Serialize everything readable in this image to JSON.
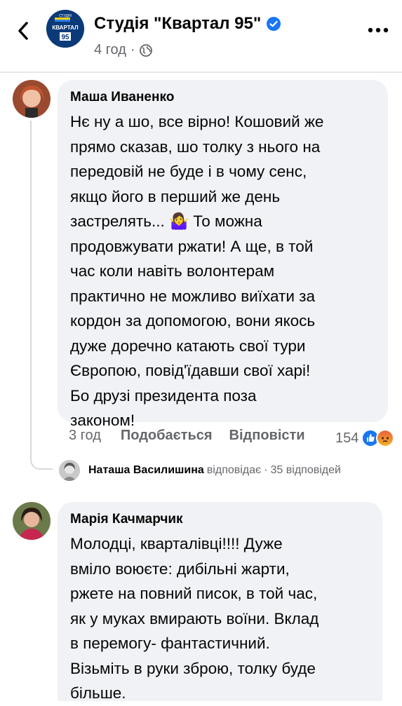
{
  "header": {
    "page_name": "Студія \"Квартал 95\"",
    "time": "4 год",
    "separator": "·",
    "logo_top": "СТУДІЯ",
    "logo_mid": "КВАРТАЛ",
    "logo_num": "95",
    "brand_color": "#0b3a78",
    "verified_color": "#1877f2"
  },
  "comments": [
    {
      "author": "Маша Иваненко",
      "text": "Нє ну а шо, все вірно! Кошовий же\nпрямо сказав, шо толку з нього на\nпередовій не буде і в чому сенс,\nякщо його в перший же день\nзастрелять... 🤷‍♀️ То можна\nпродовжувати ржати! А ще, в той\nчас коли навіть волонтерам\nпрактично не можливо виїхати за\nкордон за допомогою, вони якось\nдуже доречно катають свої тури\nЄвропою, повід'їдавши свої харі!\nБо друзі президента поза\nзаконом!",
      "time": "3 год",
      "like_label": "Подобається",
      "reply_label": "Відповісти",
      "reaction_count": "154",
      "reaction_icons": [
        "like-reaction-icon",
        "angry-reaction-icon"
      ],
      "reply_preview": {
        "name": "Наташа Василишина",
        "verb": "відповідає",
        "separator": "·",
        "count": "35 відповідей"
      }
    },
    {
      "author": "Марія Качмарчик",
      "text": "Молодці, кварталівці!!!! Дуже\nвміло воюєте: дибільні жарти,\nржете на повний писок, в той час,\nяк у муках вмирають воїни. Вклад\nв перемогу- фантастичний.\nВізьміть в руки зброю, толку буде\nбільше."
    }
  ],
  "icons": {
    "back": "back-arrow-icon",
    "verified": "verified-badge-icon",
    "audience": "globe-icon",
    "more": "more-options-icon"
  }
}
